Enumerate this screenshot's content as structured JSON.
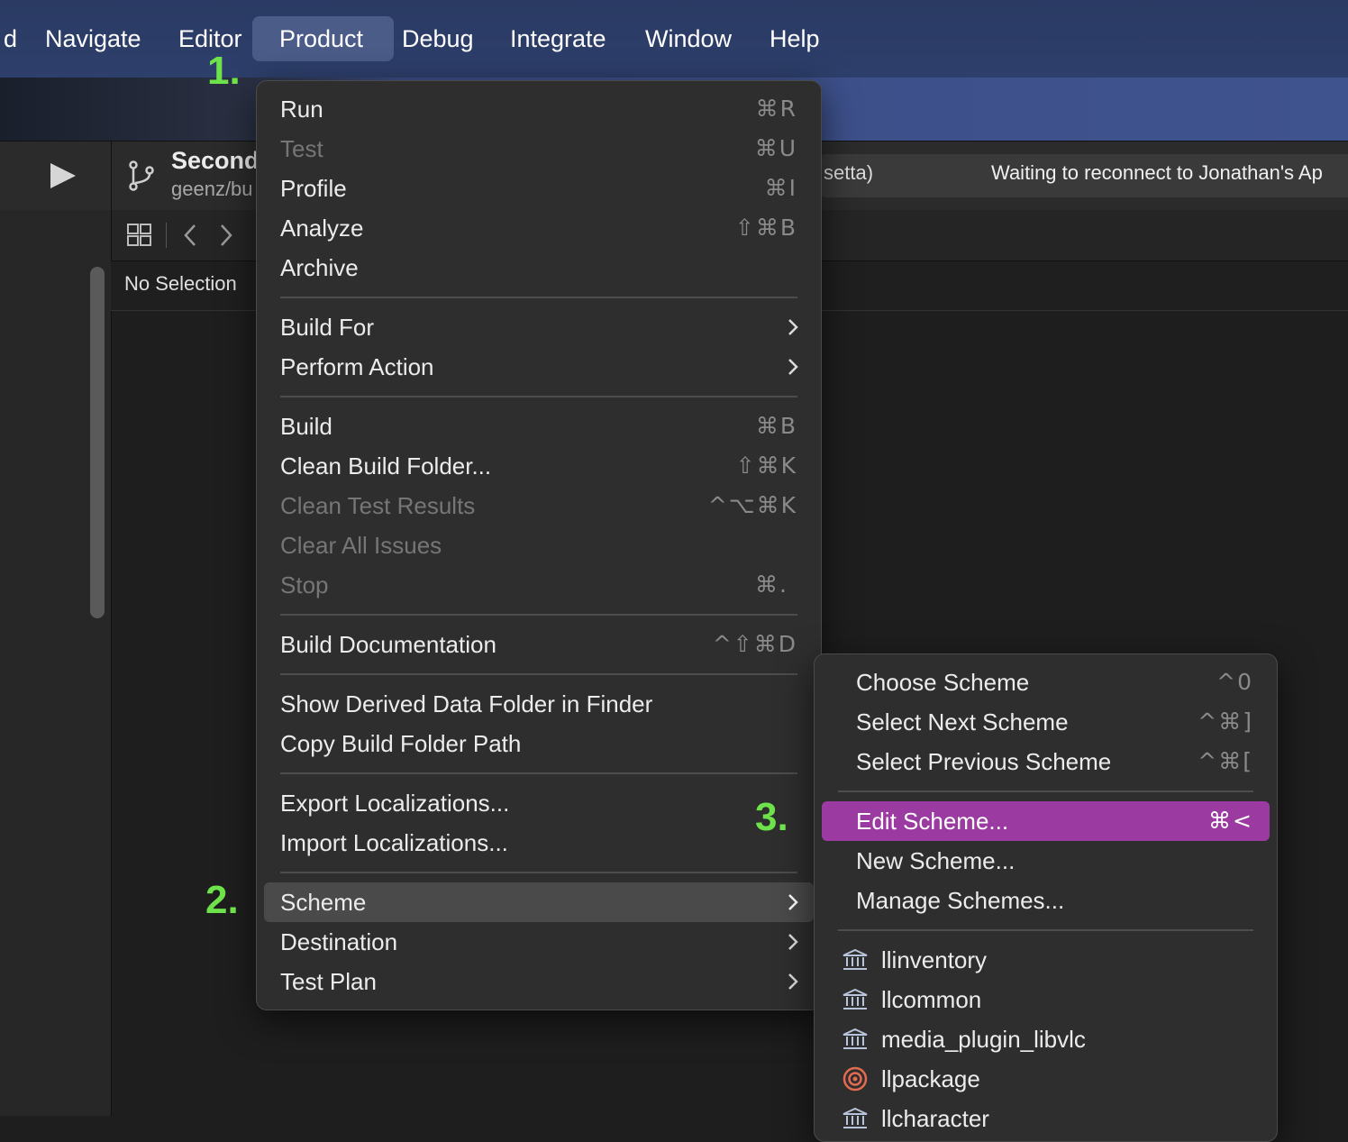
{
  "menubar": {
    "items": [
      {
        "label": "d"
      },
      {
        "label": "Navigate"
      },
      {
        "label": "Editor"
      },
      {
        "label": "Product"
      },
      {
        "label": "Debug"
      },
      {
        "label": "Integrate"
      },
      {
        "label": "Window"
      },
      {
        "label": "Help"
      }
    ]
  },
  "toolbar": {
    "scheme_name": "Second",
    "scheme_branch": "geenz/bu",
    "activity_left": "setta)",
    "activity_status": "Waiting to reconnect to Jonathan's Ap"
  },
  "editor": {
    "jumpbar_text": "No Selection"
  },
  "product_menu": {
    "items": [
      {
        "label": "Run",
        "shortcut": "⌘R",
        "disabled": false
      },
      {
        "label": "Test",
        "shortcut": "⌘U",
        "disabled": true
      },
      {
        "label": "Profile",
        "shortcut": "⌘I",
        "disabled": false
      },
      {
        "label": "Analyze",
        "shortcut": "⇧⌘B",
        "disabled": false
      },
      {
        "label": "Archive",
        "shortcut": "",
        "disabled": false
      },
      {
        "label": "Build For",
        "submenu": true
      },
      {
        "label": "Perform Action",
        "submenu": true
      },
      {
        "label": "Build",
        "shortcut": "⌘B",
        "disabled": false
      },
      {
        "label": "Clean Build Folder...",
        "shortcut": "⇧⌘K",
        "disabled": false
      },
      {
        "label": "Clean Test Results",
        "shortcut": "^⌥⌘K",
        "disabled": true
      },
      {
        "label": "Clear All Issues",
        "shortcut": "",
        "disabled": true
      },
      {
        "label": "Stop",
        "shortcut": "⌘.",
        "disabled": true
      },
      {
        "label": "Build Documentation",
        "shortcut": "^⇧⌘D",
        "disabled": false
      },
      {
        "label": "Show Derived Data Folder in Finder",
        "shortcut": ""
      },
      {
        "label": "Copy Build Folder Path",
        "shortcut": ""
      },
      {
        "label": "Export Localizations...",
        "shortcut": ""
      },
      {
        "label": "Import Localizations...",
        "shortcut": ""
      },
      {
        "label": "Scheme",
        "submenu": true,
        "highlighted": true
      },
      {
        "label": "Destination",
        "submenu": true
      },
      {
        "label": "Test Plan",
        "submenu": true
      }
    ]
  },
  "scheme_menu": {
    "items": [
      {
        "label": "Choose Scheme",
        "shortcut": "^0"
      },
      {
        "label": "Select Next Scheme",
        "shortcut": "^⌘]"
      },
      {
        "label": "Select Previous Scheme",
        "shortcut": "^⌘["
      },
      {
        "label": "Edit Scheme...",
        "shortcut": "⌘<",
        "highlighted": true
      },
      {
        "label": "New Scheme...",
        "shortcut": ""
      },
      {
        "label": "Manage Schemes...",
        "shortcut": ""
      }
    ],
    "schemes": [
      {
        "label": "llinventory",
        "icon": "library-icon"
      },
      {
        "label": "llcommon",
        "icon": "library-icon"
      },
      {
        "label": "media_plugin_libvlc",
        "icon": "library-icon"
      },
      {
        "label": "llpackage",
        "icon": "target-icon"
      },
      {
        "label": "llcharacter",
        "icon": "library-icon"
      }
    ]
  },
  "annotations": {
    "step1": "1.",
    "step2": "2.",
    "step3": "3."
  },
  "colors": {
    "highlight_purple": "#9b3aa0",
    "step_green": "#6ee24a",
    "menubar_blue": "#2d3f6b"
  }
}
